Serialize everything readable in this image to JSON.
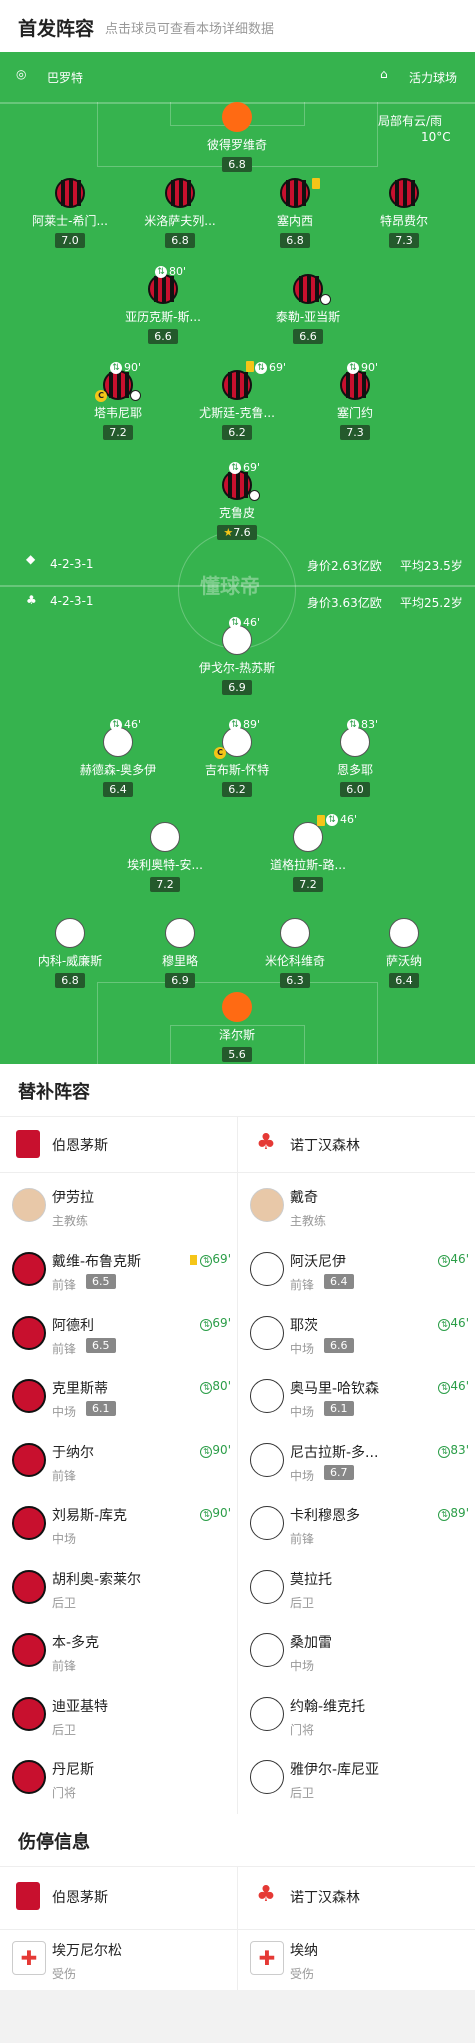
{
  "header": {
    "title": "首发阵容",
    "subtitle": "点击球员可查看本场详细数据"
  },
  "pitch_info": {
    "referee": "巴罗特",
    "stadium": "活力球场",
    "weather": "局部有云/雨",
    "temp": "10°C",
    "watermark": "懂球帝"
  },
  "home": {
    "formation": "4-2-3-1",
    "value": "身价2.63亿欧",
    "age": "平均23.5岁",
    "gk": {
      "name": "彼得罗维奇",
      "rating": "6.8"
    },
    "def": [
      {
        "name": "阿莱士-希门...",
        "rating": "7.0"
      },
      {
        "name": "米洛萨夫列...",
        "rating": "6.8"
      },
      {
        "name": "塞内西",
        "rating": "6.8"
      },
      {
        "name": "特昂费尔",
        "rating": "7.3"
      }
    ],
    "dm": [
      {
        "name": "亚历克斯-斯...",
        "rating": "6.6",
        "sub": "80'"
      },
      {
        "name": "泰勒-亚当斯",
        "rating": "6.6"
      }
    ],
    "am": [
      {
        "name": "塔韦尼耶",
        "rating": "7.2",
        "sub": "90'"
      },
      {
        "name": "尤斯廷-克鲁...",
        "rating": "6.2",
        "sub": "69'"
      },
      {
        "name": "塞门约",
        "rating": "7.3",
        "sub": "90'"
      }
    ],
    "fw": {
      "name": "克鲁皮",
      "rating": "7.6",
      "sub": "69'"
    }
  },
  "away": {
    "formation": "4-2-3-1",
    "value": "身价3.63亿欧",
    "age": "平均25.2岁",
    "fw": {
      "name": "伊戈尔-热苏斯",
      "rating": "6.9",
      "sub": "46'"
    },
    "am": [
      {
        "name": "赫德森-奥多伊",
        "rating": "6.4",
        "sub": "46'"
      },
      {
        "name": "吉布斯-怀特",
        "rating": "6.2",
        "sub": "89'"
      },
      {
        "name": "恩多耶",
        "rating": "6.0",
        "sub": "83'"
      }
    ],
    "dm": [
      {
        "name": "埃利奥特-安...",
        "rating": "7.2"
      },
      {
        "name": "道格拉斯-路...",
        "rating": "7.2",
        "sub": "46'"
      }
    ],
    "def": [
      {
        "name": "内科-威廉斯",
        "rating": "6.8"
      },
      {
        "name": "穆里略",
        "rating": "6.9"
      },
      {
        "name": "米伦科维奇",
        "rating": "6.3"
      },
      {
        "name": "萨沃纳",
        "rating": "6.4"
      }
    ],
    "gk": {
      "name": "泽尔斯",
      "rating": "5.6"
    }
  },
  "subs": {
    "title": "替补阵容",
    "home_team": "伯恩茅斯",
    "away_team": "诺丁汉森林",
    "home_coach": {
      "name": "伊劳拉",
      "role": "主教练"
    },
    "away_coach": {
      "name": "戴奇",
      "role": "主教练"
    },
    "home": [
      {
        "name": "戴维-布鲁克斯",
        "pos": "前锋",
        "rating": "6.5",
        "ev": "69'"
      },
      {
        "name": "阿德利",
        "pos": "前锋",
        "rating": "6.5",
        "ev": "69'"
      },
      {
        "name": "克里斯蒂",
        "pos": "中场",
        "rating": "6.1",
        "ev": "80'"
      },
      {
        "name": "于纳尔",
        "pos": "前锋",
        "ev": "90'"
      },
      {
        "name": "刘易斯-库克",
        "pos": "中场",
        "ev": "90'"
      },
      {
        "name": "胡利奥-索莱尔",
        "pos": "后卫"
      },
      {
        "name": "本-多克",
        "pos": "前锋"
      },
      {
        "name": "迪亚基特",
        "pos": "后卫"
      },
      {
        "name": "丹尼斯",
        "pos": "门将"
      }
    ],
    "away": [
      {
        "name": "阿沃尼伊",
        "pos": "前锋",
        "rating": "6.4",
        "ev": "46'"
      },
      {
        "name": "耶茨",
        "pos": "中场",
        "rating": "6.6",
        "ev": "46'"
      },
      {
        "name": "奥马里-哈钦森",
        "pos": "中场",
        "rating": "6.1",
        "ev": "46'"
      },
      {
        "name": "尼古拉斯-多...",
        "pos": "中场",
        "rating": "6.7",
        "ev": "83'"
      },
      {
        "name": "卡利穆恩多",
        "pos": "前锋",
        "ev": "89'"
      },
      {
        "name": "莫拉托",
        "pos": "后卫"
      },
      {
        "name": "桑加雷",
        "pos": "中场"
      },
      {
        "name": "约翰-维克托",
        "pos": "门将"
      },
      {
        "name": "雅伊尔-库尼亚",
        "pos": "后卫"
      }
    ]
  },
  "injury": {
    "title": "伤停信息",
    "home_team": "伯恩茅斯",
    "away_team": "诺丁汉森林",
    "home": [
      {
        "name": "埃万尼尔松",
        "status": "受伤"
      }
    ],
    "away": [
      {
        "name": "埃纳",
        "status": "受伤"
      }
    ]
  },
  "colors": {
    "pitch": "#36b34e",
    "rating_bg": "#245a2c",
    "home_kit": "#c8102e",
    "gk_kit": "#ff6a13",
    "sub_green": "#2a9d47",
    "yellow": "#f5c518"
  }
}
